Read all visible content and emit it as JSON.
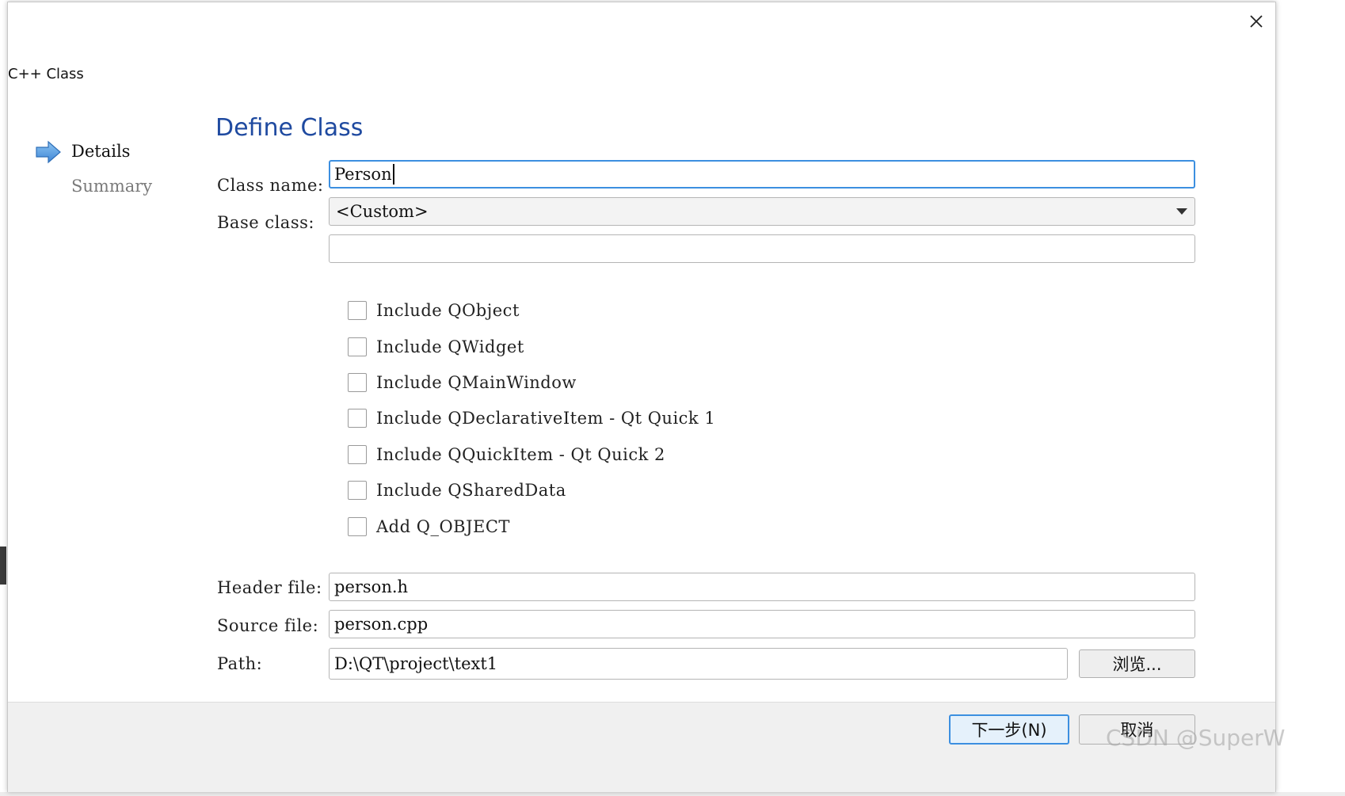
{
  "window": {
    "title": "C++ Class",
    "close_icon": "close-icon"
  },
  "wizard_steps": [
    {
      "label": "Details",
      "active": true,
      "icon": "arrow-right-icon"
    },
    {
      "label": "Summary",
      "active": false
    }
  ],
  "page": {
    "title": "Define Class"
  },
  "form": {
    "class_name_label": "Class name:",
    "class_name_value": "Person",
    "base_class_label": "Base class:",
    "base_class_value": "<Custom>",
    "custom_base_value": "",
    "checkboxes": [
      {
        "label": "Include QObject",
        "checked": false
      },
      {
        "label": "Include QWidget",
        "checked": false
      },
      {
        "label": "Include QMainWindow",
        "checked": false
      },
      {
        "label": "Include QDeclarativeItem - Qt Quick 1",
        "checked": false
      },
      {
        "label": "Include QQuickItem - Qt Quick 2",
        "checked": false
      },
      {
        "label": "Include QSharedData",
        "checked": false
      },
      {
        "label": "Add Q_OBJECT",
        "checked": false
      }
    ],
    "header_file_label": "Header file:",
    "header_file_value": "person.h",
    "source_file_label": "Source file:",
    "source_file_value": "person.cpp",
    "path_label": "Path:",
    "path_value": "D:\\QT\\project\\text1",
    "browse_label": "浏览..."
  },
  "footer": {
    "next_label": "下一步(N)",
    "cancel_label": "取消"
  },
  "watermark": "CSDN @SuperW",
  "colors": {
    "accent": "#3c8fe0",
    "title_blue": "#1f4aa0",
    "footer_bg": "#f0f0f0"
  }
}
